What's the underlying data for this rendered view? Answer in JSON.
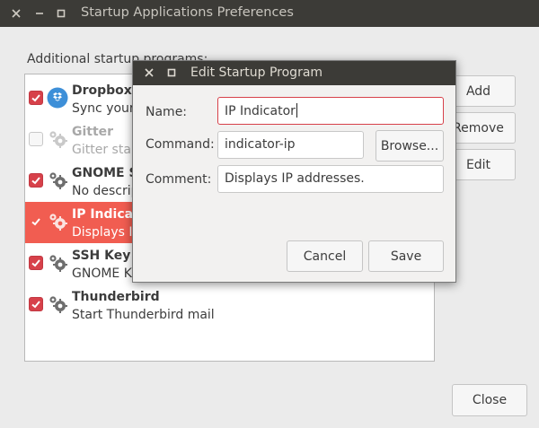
{
  "window": {
    "title": "Startup Applications Preferences",
    "section_label": "Additional startup programs:"
  },
  "colors": {
    "accent": "#f15d51",
    "checkbox": "#d7414a",
    "titlebar": "#3c3b37"
  },
  "programs": [
    {
      "name": "Dropbox",
      "desc": "Sync your files across computers and to the web",
      "checked": true,
      "icon": "dropbox-icon"
    },
    {
      "name": "Gitter",
      "desc": "Gitter startup",
      "checked": false,
      "icon": "gear-icon"
    },
    {
      "name": "GNOME Software",
      "desc": "No description",
      "checked": true,
      "icon": "gear-icon"
    },
    {
      "name": "IP Indicator",
      "desc": "Displays IP addresses.",
      "checked": true,
      "icon": "gear-icon"
    },
    {
      "name": "SSH Key Agent",
      "desc": "GNOME Keyring: SSH Agent",
      "checked": true,
      "icon": "gear-icon"
    },
    {
      "name": "Thunderbird",
      "desc": "Start Thunderbird mail",
      "checked": true,
      "icon": "gear-icon"
    }
  ],
  "buttons": {
    "add": "Add",
    "remove": "Remove",
    "edit": "Edit",
    "close": "Close"
  },
  "dialog": {
    "title": "Edit Startup Program",
    "name_label": "Name:",
    "name_value": "IP Indicator",
    "command_label": "Command:",
    "command_value": "indicator-ip",
    "browse_label": "Browse...",
    "comment_label": "Comment:",
    "comment_value": "Displays IP addresses.",
    "cancel_label": "Cancel",
    "save_label": "Save"
  }
}
